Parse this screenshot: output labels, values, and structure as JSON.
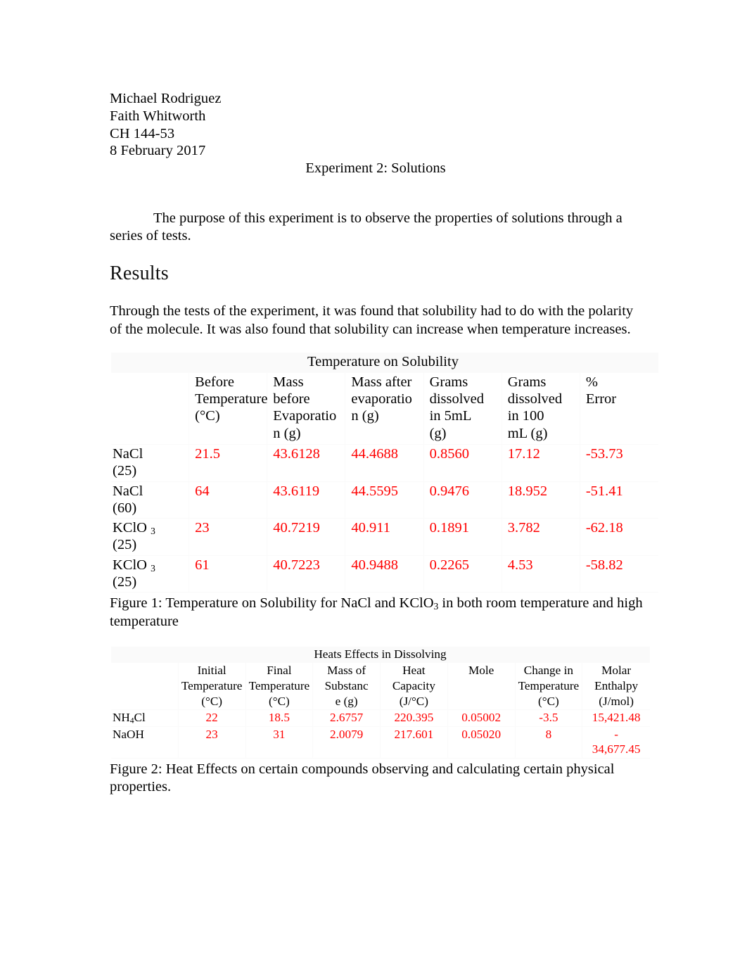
{
  "header": {
    "student_name": "Michael Rodriguez",
    "partner_name": "Faith Whitworth",
    "course": "CH 144-53",
    "date": "8 February 2017",
    "experiment_title": "Experiment 2: Solutions"
  },
  "purpose": {
    "text": "The purpose of this experiment is to observe the properties of solutions through a series of tests."
  },
  "results": {
    "heading": "Results",
    "summary": "Through the tests of the experiment, it was found that solubility had to do with the polarity of the molecule. It was also found that solubility can increase when temperature increases."
  },
  "table1": {
    "caption": "Temperature on Solubility",
    "columns": [
      "",
      "Before Temperature (°C)",
      "Mass before Evaporation (g)",
      "Mass after evaporation (g)",
      "Grams dissolved in 5mL (g)",
      "Grams dissolved in 100 mL (g)",
      "% Error"
    ],
    "column_parts": [
      {
        "l1": "",
        "l2": "",
        "l3": ""
      },
      {
        "l1": "Before",
        "l2": "Temperature",
        "l3": "(°C)"
      },
      {
        "l1": "Mass before",
        "l2": "Evaporatio",
        "l3": "n (g)"
      },
      {
        "l1": "Mass after",
        "l2": "evaporatio",
        "l3": "n (g)"
      },
      {
        "l1": "Grams",
        "l2": "dissolved",
        "l3": "in 5mL",
        "l4": "(g)"
      },
      {
        "l1": "Grams",
        "l2": "dissolved",
        "l3": "in 100",
        "l4": "mL (g)"
      },
      {
        "l1": "%",
        "l2": "Error",
        "l3": ""
      }
    ],
    "rows": [
      {
        "label_main": "NaCl",
        "label_sub": "",
        "label_paren": "(25)",
        "before_temp": "21.5",
        "mass_before": "43.6128",
        "mass_after": "44.4688",
        "grams_5ml": "0.8560",
        "grams_100ml": "17.12",
        "percent_error": "-53.73"
      },
      {
        "label_main": "NaCl",
        "label_sub": "",
        "label_paren": "(60)",
        "before_temp": "64",
        "mass_before": "43.6119",
        "mass_after": "44.5595",
        "grams_5ml": "0.9476",
        "grams_100ml": "18.952",
        "percent_error": "-51.41"
      },
      {
        "label_main": "KClO",
        "label_sub": "3",
        "label_paren": "(25)",
        "before_temp": "23",
        "mass_before": "40.7219",
        "mass_after": "40.911",
        "grams_5ml": "0.1891",
        "grams_100ml": "3.782",
        "percent_error": "-62.18"
      },
      {
        "label_main": "KClO",
        "label_sub": "3",
        "label_paren": "(25)",
        "before_temp": "61",
        "mass_before": "40.7223",
        "mass_after": "40.9488",
        "grams_5ml": "0.2265",
        "grams_100ml": "4.53",
        "percent_error": "-58.82"
      }
    ]
  },
  "figure1": {
    "caption_prefix": "Figure 1:",
    "caption_body_a": "  Temperature on Solubility for NaCl and KClO",
    "caption_sub": "3",
    "caption_body_b": " in both room temperature and high temperature"
  },
  "table2": {
    "caption": "Heats Effects in Dissolving",
    "columns": [
      "",
      "Initial Temperature (°C)",
      "Final Temperature (°C)",
      "Mass of Substance (g)",
      "Heat Capacity (J/°C)",
      "Mole",
      "Change in Temperature (°C)",
      "Molar Enthalpy (J/mol)"
    ],
    "column_parts": [
      {
        "l1": "",
        "l2": "",
        "l3": ""
      },
      {
        "l1": "Initial",
        "l2": "Temperature",
        "l3": "(°C)"
      },
      {
        "l1": "Final",
        "l2": "Temperature",
        "l3": "(°C)"
      },
      {
        "l1": "Mass of",
        "l2": "Substanc",
        "l3": "e (g)"
      },
      {
        "l1": "Heat",
        "l2": "Capacity",
        "l3": "(J/°C)"
      },
      {
        "l1": "Mole",
        "l2": "",
        "l3": ""
      },
      {
        "l1": "Change in",
        "l2": "Temperature",
        "l3": "(°C)"
      },
      {
        "l1": "Molar",
        "l2": "Enthalpy",
        "l3": "(J/mol)"
      }
    ],
    "rows": [
      {
        "label_pre": "NH",
        "label_sub": "4",
        "label_post": "Cl",
        "initial_temp": "22",
        "final_temp": "18.5",
        "mass": "2.6757",
        "heat_capacity": "220.395",
        "mole": "0.05002",
        "delta_temp": "-3.5",
        "molar_enthalpy": "15,421.48"
      },
      {
        "label_pre": "NaOH",
        "label_sub": "",
        "label_post": "",
        "initial_temp": "23",
        "final_temp": "31",
        "mass": "2.0079",
        "heat_capacity": "217.601",
        "mole": "0.05020",
        "delta_temp": "8",
        "molar_enthalpy": "-\n34,677.45"
      }
    ]
  },
  "figure2": {
    "caption": "Figure 2:  Heat Effects on certain compounds observing and calculating certain physical properties."
  },
  "colors": {
    "data_value": "#ff0000",
    "text": "#000000",
    "page_background": "#ffffff",
    "table_gridline": "#fafafa"
  }
}
